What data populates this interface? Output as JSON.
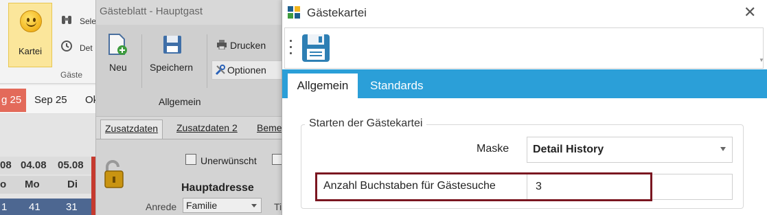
{
  "ribbon": {
    "kartei_label": "Kartei",
    "item1_label": "Sele",
    "item2_label": "Det",
    "group_label": "Gäste"
  },
  "calendar": {
    "prev_partial": "g 25",
    "month_label": "Sep 25",
    "next_partial": "Ok",
    "dates": [
      "08",
      "04.08",
      "05.08"
    ],
    "weekdays": [
      "o",
      "Mo",
      "Di"
    ],
    "counts": [
      "1",
      "41",
      "31"
    ]
  },
  "guest_sheet": {
    "title": "Gästeblatt - Hauptgast",
    "neu_label": "Neu",
    "speichern_label": "Speichern",
    "drucken_label": "Drucken",
    "optionen_label": "Optionen",
    "group_label": "Allgemein",
    "tabs": [
      "Zusatzdaten",
      "Zusatzdaten 2",
      "Beme"
    ],
    "unerwuenscht_label": "Unerwünscht",
    "hauptadresse_label": "Hauptadresse",
    "anrede_label": "Anrede",
    "anrede_value": "Familie",
    "ti_label": "Ti"
  },
  "dialog": {
    "title": "Gästekartei",
    "tabs": {
      "allgemein": "Allgemein",
      "standards": "Standards"
    },
    "group_title": "Starten der Gästekartei",
    "maske_label": "Maske",
    "maske_value": "Detail History",
    "anzahl_label": "Anzahl Buchstaben für Gästesuche",
    "anzahl_value": "3",
    "colors": {
      "tabbar": "#2b9fd8",
      "highlight": "#7a1620"
    }
  }
}
